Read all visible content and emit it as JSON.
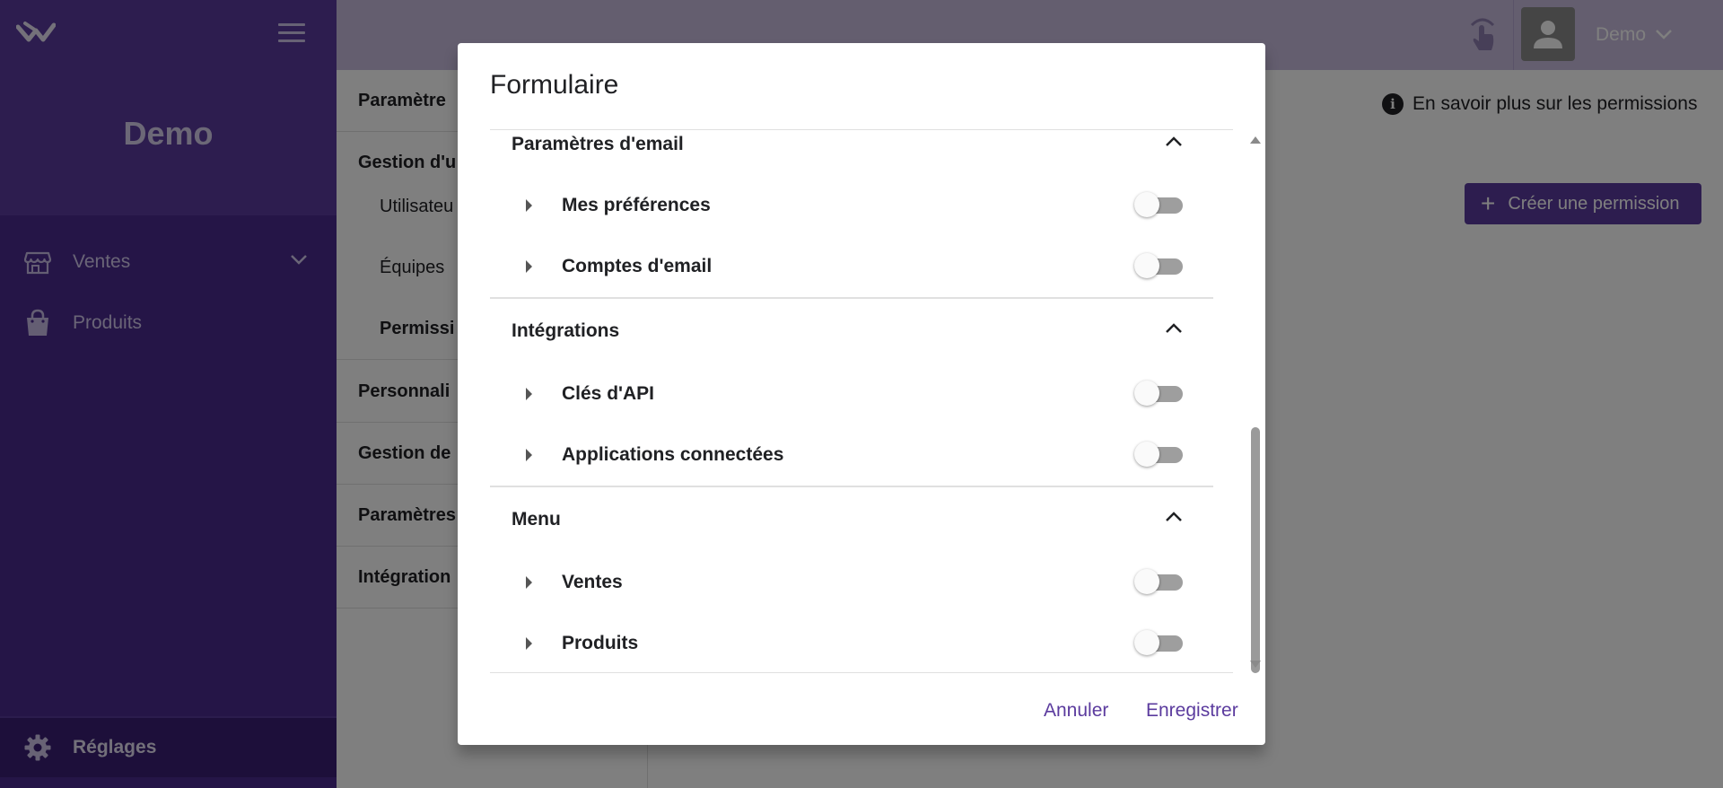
{
  "sidebar": {
    "brand": "Demo",
    "items": [
      {
        "label": "Ventes",
        "icon": "store-icon"
      },
      {
        "label": "Produits",
        "icon": "shopping-bag-icon"
      }
    ],
    "settings_label": "Réglages"
  },
  "appbar": {
    "user_name": "Demo"
  },
  "subnav": {
    "items": [
      {
        "label": "Paramètre",
        "type": "section"
      },
      {
        "label": "Gestion d'u",
        "type": "section-open"
      },
      {
        "label": "Utilisateu",
        "type": "child"
      },
      {
        "label": "Équipes",
        "type": "child"
      },
      {
        "label": "Permissi",
        "type": "child-active"
      },
      {
        "label": "Personnali",
        "type": "section"
      },
      {
        "label": "Gestion de",
        "type": "section"
      },
      {
        "label": "Paramètres",
        "type": "section"
      },
      {
        "label": "Intégration",
        "type": "section"
      }
    ]
  },
  "main": {
    "info_text": "En savoir plus sur les permissions",
    "create_button": "Créer une permission"
  },
  "dialog": {
    "title": "Formulaire",
    "groups": [
      {
        "title": "Paramètres d'email",
        "rows": [
          {
            "label": "Mes préférences",
            "enabled": false
          },
          {
            "label": "Comptes d'email",
            "enabled": false
          }
        ]
      },
      {
        "title": "Intégrations",
        "rows": [
          {
            "label": "Clés d'API",
            "enabled": false
          },
          {
            "label": "Applications connectées",
            "enabled": false
          }
        ]
      },
      {
        "title": "Menu",
        "rows": [
          {
            "label": "Ventes",
            "enabled": false
          },
          {
            "label": "Produits",
            "enabled": false
          }
        ]
      }
    ],
    "cancel_label": "Annuler",
    "save_label": "Enregistrer"
  },
  "colors": {
    "primary": "#5b3b9e",
    "sidebar": "#4a2a8f",
    "appbar": "#c9bddf"
  }
}
